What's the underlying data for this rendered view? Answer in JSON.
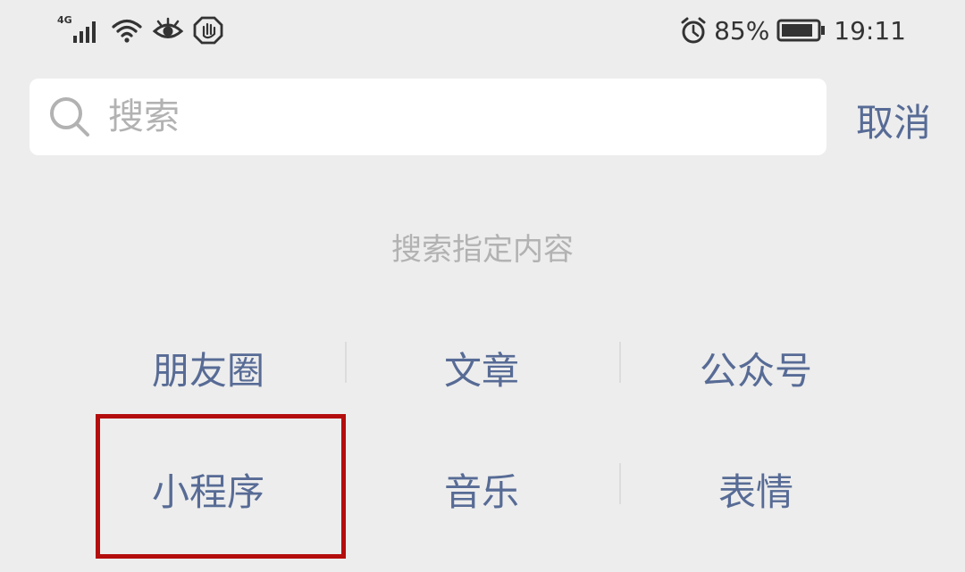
{
  "status_bar": {
    "network": "4G",
    "battery": "85%",
    "time": "19:11"
  },
  "search": {
    "placeholder": "搜索",
    "cancel_label": "取消"
  },
  "section_title": "搜索指定内容",
  "categories": [
    {
      "label": "朋友圈"
    },
    {
      "label": "文章"
    },
    {
      "label": "公众号"
    },
    {
      "label": "小程序"
    },
    {
      "label": "音乐"
    },
    {
      "label": "表情"
    }
  ],
  "colors": {
    "background": "#ededed",
    "link": "#576b95",
    "hint": "#b2b2b2",
    "highlight": "#b40d0d"
  },
  "icons": [
    "signal-icon",
    "wifi-icon",
    "eye-icon",
    "hand-icon",
    "alarm-icon",
    "battery-icon",
    "search-icon"
  ]
}
